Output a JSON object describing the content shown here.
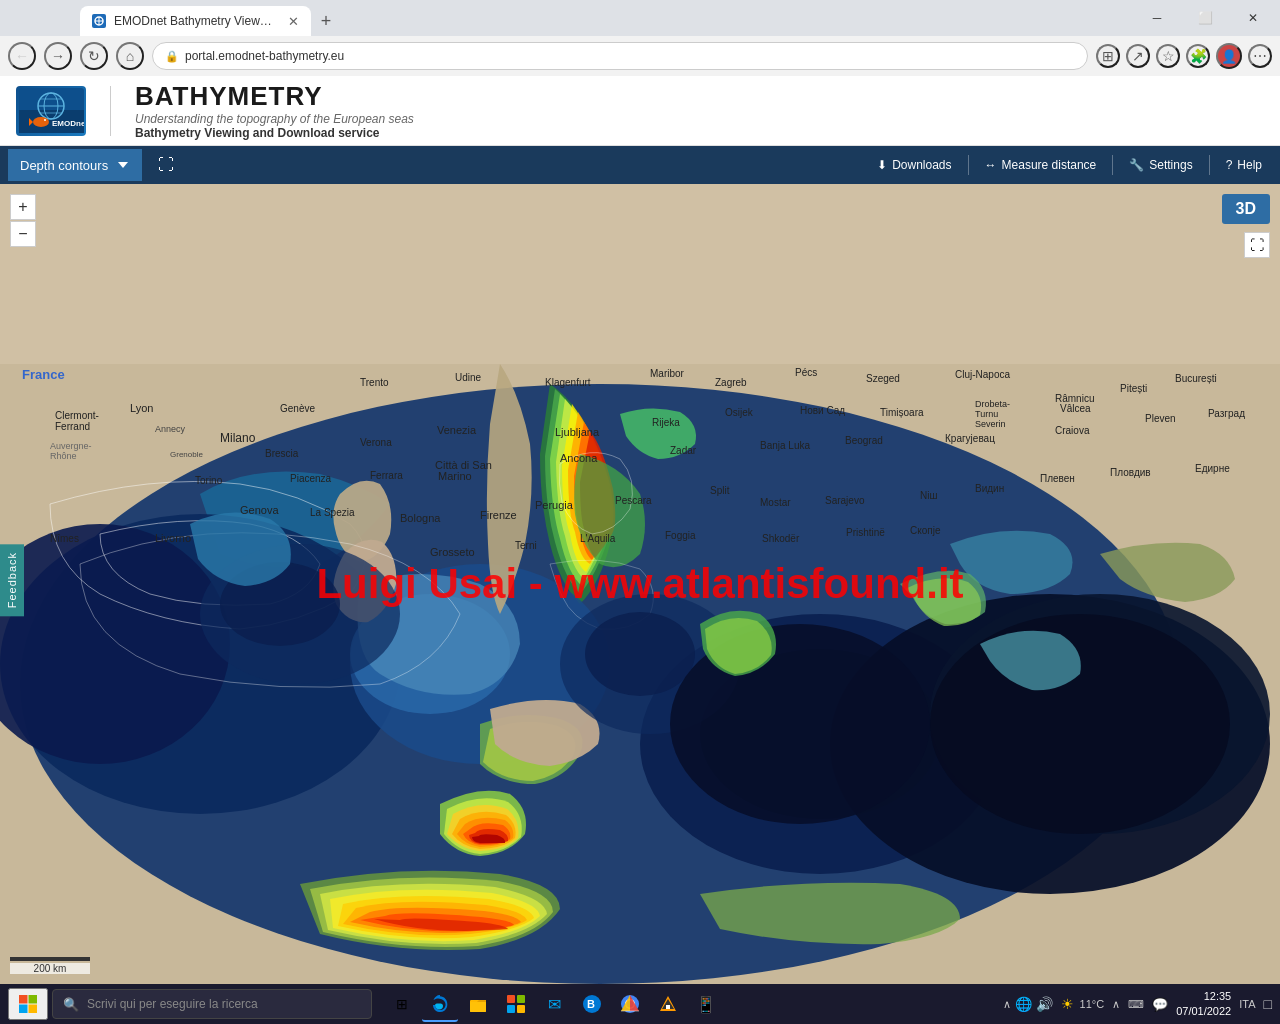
{
  "browser": {
    "tab_title": "EMODnet Bathymetry Viewing a…",
    "url": "portal.emodnet-bathymetry.eu",
    "new_tab_label": "+"
  },
  "header": {
    "logo_text": "EMODnet",
    "title": "BATHYMETRY",
    "subtitle": "Understanding the topography of the European seas",
    "subtitle2": "Bathymetry Viewing and Download service"
  },
  "toolbar": {
    "depth_contours": "Depth contours",
    "downloads": "Downloads",
    "measure_distance": "Measure distance",
    "settings": "Settings",
    "help": "Help"
  },
  "map": {
    "watermark": "Luigi Usai - www.atlantisfound.it",
    "btn_3d": "3D",
    "scale_label": "200 km",
    "zoom_in": "+",
    "zoom_out": "−"
  },
  "taskbar": {
    "search_placeholder": "Scrivi qui per eseguire la ricerca",
    "time": "12:35",
    "date": "07/01/2022",
    "temperature": "11°C",
    "language": "ITA"
  }
}
